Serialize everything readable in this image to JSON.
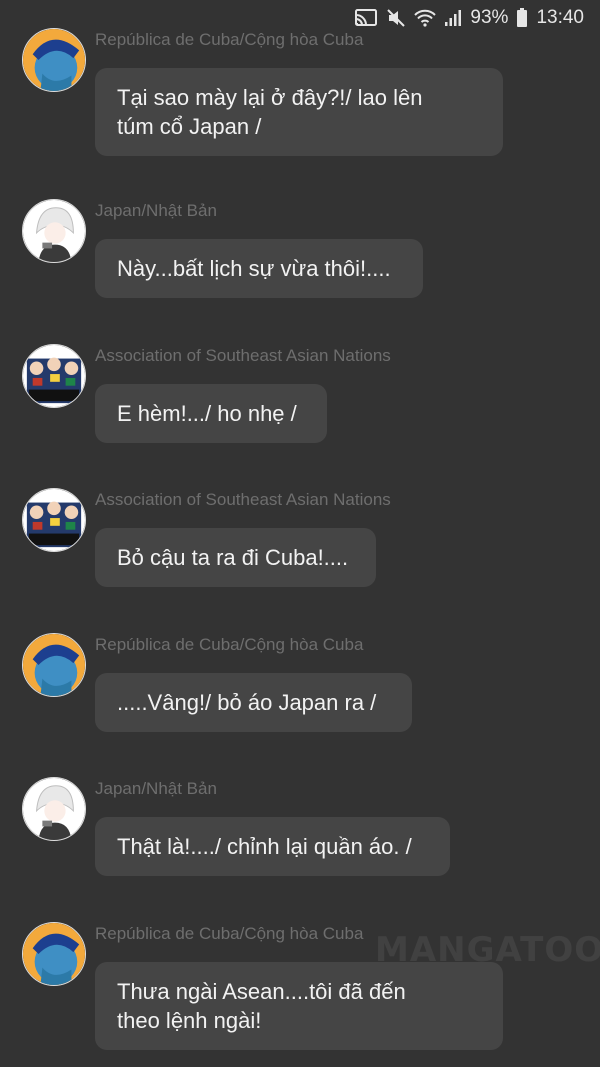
{
  "status_bar": {
    "battery": "93%",
    "time": "13:40",
    "icons": [
      "cast-icon",
      "mute-icon",
      "wifi-icon",
      "signal-icon",
      "battery-icon"
    ]
  },
  "messages": [
    {
      "sender": "República de Cuba/Cộng hòa Cuba",
      "text": "Tại sao mày lại ở đây?!/ lao lên\ntúm cổ Japan /",
      "avatar": "cuba-avatar"
    },
    {
      "sender": "Japan/Nhật Bản",
      "text": "Này...bất lịch sự vừa thôi!....",
      "avatar": "japan-avatar"
    },
    {
      "sender": "Association of Southeast Asian Nations",
      "text": "E hèm!.../ ho nhẹ /",
      "avatar": "asean-avatar"
    },
    {
      "sender": "Association of Southeast Asian Nations",
      "text": "Bỏ cậu ta ra đi Cuba!....",
      "avatar": "asean-avatar"
    },
    {
      "sender": "República de Cuba/Cộng hòa Cuba",
      "text": ".....Vâng!/ bỏ áo Japan ra /",
      "avatar": "cuba-avatar"
    },
    {
      "sender": "Japan/Nhật Bản",
      "text": "Thật là!..../ chỉnh lại quần áo. /",
      "avatar": "japan-avatar"
    },
    {
      "sender": "República de Cuba/Cộng hòa Cuba",
      "text": "Thưa ngài Asean....tôi đã đến\ntheo lệnh ngài!",
      "avatar": "cuba-avatar"
    }
  ],
  "watermark": "MANGATOON",
  "colors": {
    "background": "#333333",
    "bubble": "#454545",
    "sender_name": "#6e6e6e",
    "message_text": "#f2f2f2"
  }
}
